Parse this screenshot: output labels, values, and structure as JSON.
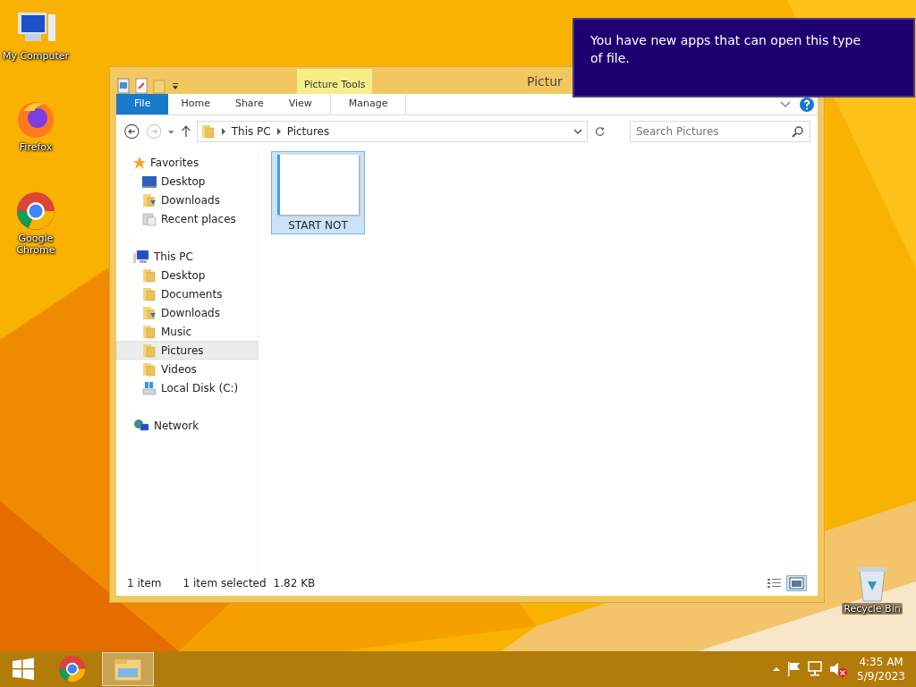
{
  "desktop_icons": [
    {
      "label": "My Computer",
      "kind": "computer"
    },
    {
      "label": "Firefox",
      "kind": "firefox"
    },
    {
      "label": "Google Chrome",
      "kind": "chrome"
    },
    {
      "label": "Recycle Bin",
      "kind": "recycle"
    }
  ],
  "notification": {
    "text": "You have new apps that can open this type of file."
  },
  "explorer": {
    "title": "Pictur",
    "contextual_group": "Picture Tools",
    "ribbon_tabs": [
      {
        "label": "File",
        "kind": "file"
      },
      {
        "label": "Home",
        "kind": "plain"
      },
      {
        "label": "Share",
        "kind": "plain"
      },
      {
        "label": "View",
        "kind": "plain"
      },
      {
        "label": "Manage",
        "kind": "contextual"
      }
    ],
    "breadcrumb": [
      "This PC",
      "Pictures"
    ],
    "search": {
      "placeholder": "Search Pictures"
    },
    "nav": [
      {
        "label": "Favorites",
        "kind": "star",
        "selected": false,
        "children": [
          {
            "label": "Desktop",
            "kind": "desktop",
            "selected": false
          },
          {
            "label": "Downloads",
            "kind": "downloads",
            "selected": false
          },
          {
            "label": "Recent places",
            "kind": "recent",
            "selected": false
          }
        ]
      },
      {
        "label": "This PC",
        "kind": "pc",
        "selected": false,
        "children": [
          {
            "label": "Desktop",
            "kind": "folder",
            "selected": false
          },
          {
            "label": "Documents",
            "kind": "folder",
            "selected": false
          },
          {
            "label": "Downloads",
            "kind": "downloads",
            "selected": false
          },
          {
            "label": "Music",
            "kind": "folder",
            "selected": false
          },
          {
            "label": "Pictures",
            "kind": "folder",
            "selected": true
          },
          {
            "label": "Videos",
            "kind": "folder",
            "selected": false
          },
          {
            "label": "Local Disk (C:)",
            "kind": "disk",
            "selected": false
          }
        ]
      },
      {
        "label": "Network",
        "kind": "network",
        "selected": false
      }
    ],
    "files": [
      {
        "name": "START NOT",
        "selected": true
      }
    ],
    "status": {
      "count": "1 item",
      "selection": "1 item selected",
      "size": "1.82 KB"
    },
    "view_modes": [
      {
        "kind": "details",
        "selected": false
      },
      {
        "kind": "large",
        "selected": true
      }
    ]
  },
  "taskbar": {
    "apps": [
      {
        "kind": "chrome",
        "active": false
      },
      {
        "kind": "explorer",
        "active": true
      }
    ],
    "time": "4:35 AM",
    "date": "5/9/2023"
  }
}
